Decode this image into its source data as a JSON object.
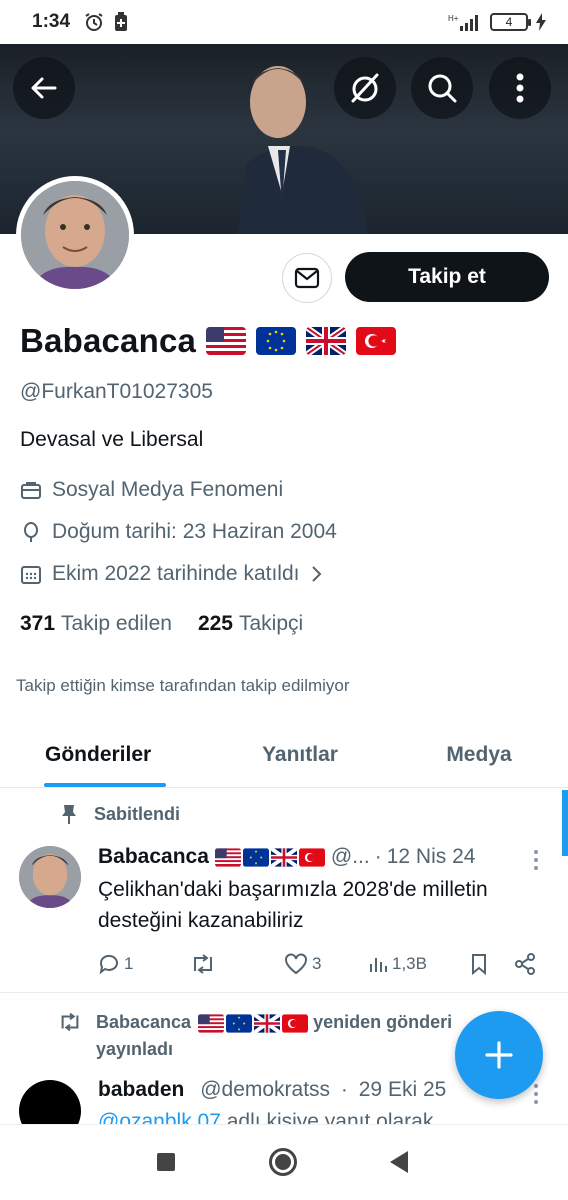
{
  "status_bar": {
    "time": "1:34",
    "network": "H+",
    "battery": "4"
  },
  "header": {
    "back_icon": "arrow-left-icon",
    "grok_icon": "slash-circle-icon",
    "search_icon": "search-icon",
    "more_icon": "more-vertical-icon"
  },
  "profile": {
    "display_name": "Babacanca",
    "flags": [
      "US",
      "EU",
      "GB",
      "TR"
    ],
    "handle": "@FurkanT01027305",
    "bio": "Devasal ve Libersal",
    "category": "Sosyal Medya Fenomeni",
    "birthday": "Doğum tarihi: 23 Haziran 2004",
    "joined": "Ekim 2022 tarihinde katıldı",
    "following_count": "371",
    "following_label": "Takip edilen",
    "followers_count": "225",
    "followers_label": "Takipçi",
    "not_followed_note": "Takip ettiğin kimse tarafından takip edilmiyor"
  },
  "actions": {
    "message_icon": "mail-icon",
    "follow_label": "Takip et"
  },
  "tabs": [
    {
      "label": "Gönderiler",
      "active": true
    },
    {
      "label": "Yanıtlar",
      "active": false
    },
    {
      "label": "Medya",
      "active": false
    }
  ],
  "pinned_post": {
    "pinned_label": "Sabitlendi",
    "author": "Babacanca",
    "handle": "@...",
    "time": "12 Nis 24",
    "text": "Çelikhan'daki başarımızla 2028'de milletin desteğini kazanabiliriz",
    "replies": "1",
    "reposts": "",
    "likes": "3",
    "views": "1,3B"
  },
  "repost": {
    "reposter": "Babacanca",
    "label_suffix": "yeniden gönderi",
    "label_line2": "yayınladı",
    "author": "babaden",
    "handle": "@demokratss",
    "time": "29 Eki 25",
    "reply_mention": "@ozanblk 07",
    "reply_suffix": "adlı kişiye yanıt olarak"
  },
  "colors": {
    "accent": "#1d9bf0",
    "text_primary": "#0f1419",
    "text_secondary": "#536471",
    "follow_button_bg": "#0f1419"
  }
}
